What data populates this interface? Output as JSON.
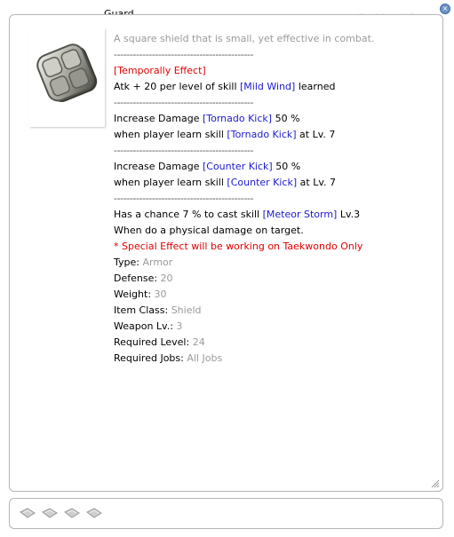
{
  "window": {
    "title": "Guard",
    "watermark": "Collections"
  },
  "item": {
    "description": "A square shield that is small, yet effective in combat.",
    "separator": "--------------------------------------------",
    "effect_header": "[Temporally Effect]",
    "effect1": {
      "pre": "Atk + 20 per level of skill ",
      "skill": "[Mild Wind]",
      "post": " learned"
    },
    "effect2": {
      "line1": {
        "pre": "Increase Damage ",
        "skill": "[Tornado Kick]",
        "post": " 50 %"
      },
      "line2": {
        "pre": "when player learn skill ",
        "skill": "[Tornado Kick]",
        "post": " at Lv. 7"
      }
    },
    "effect3": {
      "line1": {
        "pre": "Increase Damage ",
        "skill": "[Counter Kick]",
        "post": " 50 %"
      },
      "line2": {
        "pre": "when player learn skill ",
        "skill": "[Counter Kick]",
        "post": " at Lv. 7"
      }
    },
    "effect4": {
      "line1": {
        "pre": "Has a chance 7 % to cast skill ",
        "skill": "[Meteor Storm]",
        "post": " Lv.3"
      },
      "line2": "When do a physical damage on target."
    },
    "special_note": "* Special Effect will be working on Taekwondo Only",
    "stats": [
      {
        "label": "Type:",
        "value": "Armor"
      },
      {
        "label": "Defense:",
        "value": "20"
      },
      {
        "label": "Weight:",
        "value": "30"
      },
      {
        "label": "Item Class:",
        "value": "Shield"
      },
      {
        "label": "Weapon Lv.:",
        "value": "3"
      },
      {
        "label": "Required Level:",
        "value": "24"
      },
      {
        "label": "Required Jobs:",
        "value": "All Jobs"
      }
    ]
  },
  "slots": {
    "count": 4,
    "icon": "card-slot-icon"
  },
  "colors": {
    "skill": "#1a1acf",
    "effect": "#e20000",
    "muted": "#9a9a9a"
  }
}
